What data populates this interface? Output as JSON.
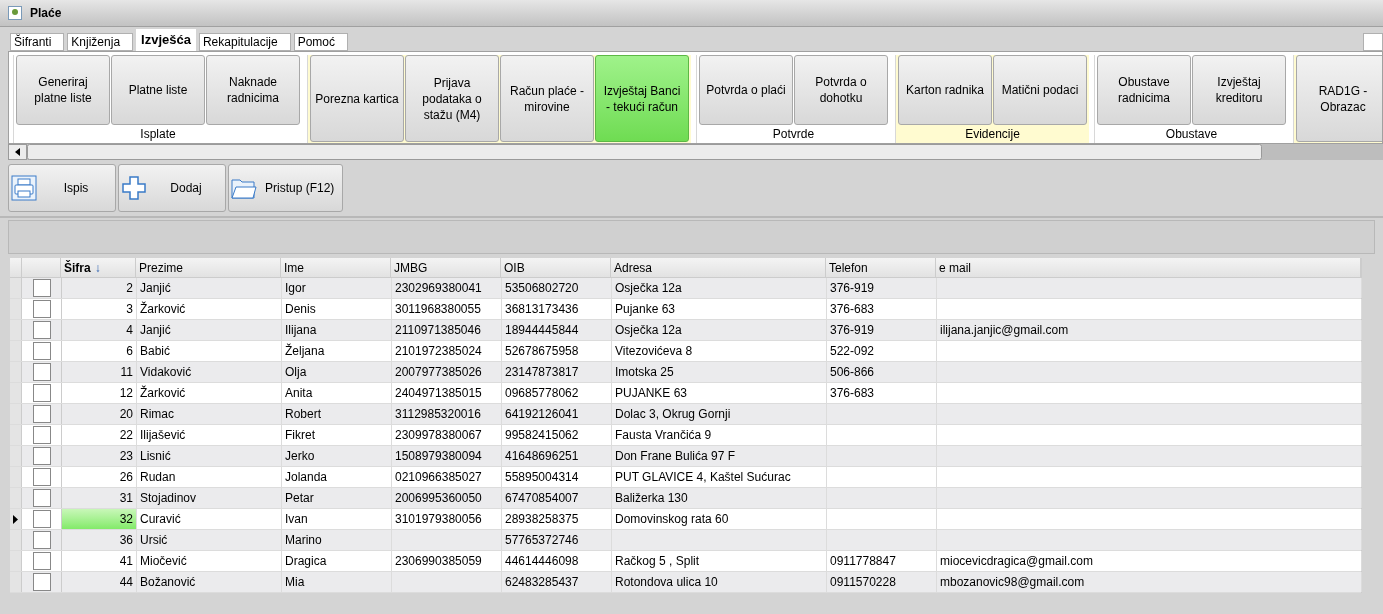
{
  "window": {
    "title": "Plaće"
  },
  "tabs": [
    {
      "label": "Šifranti",
      "selected": false
    },
    {
      "label": "Knjiženja",
      "selected": false
    },
    {
      "label": "Izvješća",
      "selected": true
    },
    {
      "label": "Rekapitulacije",
      "selected": false
    },
    {
      "label": "Pomoć",
      "selected": false
    }
  ],
  "ribbon_groups": [
    {
      "label": "Isplate",
      "color": "#ffffff",
      "buttons": [
        {
          "label": "Generiraj platne liste",
          "selected": false
        },
        {
          "label": "Platne liste",
          "selected": false
        },
        {
          "label": "Naknade radnicima",
          "selected": false
        }
      ]
    },
    {
      "color": "#fffbd0",
      "buttons": [
        {
          "label": "Porezna kartica",
          "selected": false
        },
        {
          "label": "Prijava podataka o stažu (M4)",
          "selected": false
        },
        {
          "label": "Račun plaće - mirovine",
          "selected": false
        },
        {
          "label": "Izvještaj Banci - tekući račun",
          "selected": true
        }
      ]
    },
    {
      "label": "Potvrde",
      "color": "#ffffff",
      "buttons": [
        {
          "label": "Potvrda o plaći",
          "selected": false
        },
        {
          "label": "Potvrda o dohotku",
          "selected": false
        }
      ]
    },
    {
      "label": "Evidencije",
      "color": "#fffbd0",
      "buttons": [
        {
          "label": "Karton radnika",
          "selected": false
        },
        {
          "label": "Matični podaci",
          "selected": false
        }
      ]
    },
    {
      "label": "Obustave",
      "color": "#ffffff",
      "buttons": [
        {
          "label": "Obustave radnicima",
          "selected": false
        },
        {
          "label": "Izvještaj kreditoru",
          "selected": false
        }
      ]
    },
    {
      "color": "#fffbd0",
      "buttons": [
        {
          "label": "RAD1G - Obrazac",
          "selected": false
        }
      ]
    }
  ],
  "toolbar": [
    {
      "label": "Ispis",
      "kind": "printer"
    },
    {
      "label": "Dodaj",
      "kind": "plus"
    },
    {
      "label": "Pristup (F12)",
      "kind": "folder"
    }
  ],
  "table": {
    "columns": [
      {
        "label": "Šifra",
        "sort": "↓"
      },
      {
        "label": "Prezime"
      },
      {
        "label": "Ime"
      },
      {
        "label": "JMBG"
      },
      {
        "label": "OIB"
      },
      {
        "label": "Adresa"
      },
      {
        "label": "Telefon"
      },
      {
        "label": "e mail"
      }
    ],
    "rows": [
      {
        "current": false,
        "checked": false,
        "cells": [
          "2",
          "Janjić",
          "Igor",
          "2302969380041",
          "53506802720",
          "Osječka 12a",
          "376-919",
          ""
        ]
      },
      {
        "current": false,
        "checked": false,
        "cells": [
          "3",
          "Žarković",
          "Denis",
          "3011968380055",
          "36813173436",
          "Pujanke 63",
          "376-683",
          ""
        ]
      },
      {
        "current": false,
        "checked": false,
        "cells": [
          "4",
          "Janjić",
          "Ilijana",
          "2110971385046",
          "18944445844",
          "Osječka 12a",
          "376-919",
          "ilijana.janjic@gmail.com"
        ]
      },
      {
        "current": false,
        "checked": false,
        "cells": [
          "6",
          "Babić",
          "Željana",
          "2101972385024",
          "52678675958",
          "Vitezovićeva 8",
          "522-092",
          ""
        ]
      },
      {
        "current": false,
        "checked": false,
        "cells": [
          "11",
          "Vidaković",
          "Olja",
          "2007977385026",
          "23147873817",
          "Imotska 25",
          "506-866",
          ""
        ]
      },
      {
        "current": false,
        "checked": false,
        "cells": [
          "12",
          "Žarković",
          "Anita",
          "2404971385015",
          "09685778062",
          "PUJANKE 63",
          "376-683",
          ""
        ]
      },
      {
        "current": false,
        "checked": false,
        "cells": [
          "20",
          "Rimac",
          "Robert",
          "3112985320016",
          "64192126041",
          "Dolac 3, Okrug Gornji",
          "",
          ""
        ]
      },
      {
        "current": false,
        "checked": false,
        "cells": [
          "22",
          "Ilijašević",
          "Fikret",
          "2309978380067",
          "99582415062",
          "Fausta Vrančića 9",
          "",
          ""
        ]
      },
      {
        "current": false,
        "checked": false,
        "cells": [
          "23",
          "Lisnić",
          "Jerko",
          "1508979380094",
          "41648696251",
          "Don Frane Bulića 97 F",
          "",
          ""
        ]
      },
      {
        "current": false,
        "checked": false,
        "cells": [
          "26",
          "Rudan",
          "Jolanda",
          "0210966385027",
          "55895004314",
          "PUT GLAVICE 4, Kaštel Sućurac",
          "",
          ""
        ]
      },
      {
        "current": false,
        "checked": false,
        "cells": [
          "31",
          "Stojadinov",
          "Petar",
          "2006995360050",
          "67470854007",
          "Baližerka 130",
          "",
          ""
        ]
      },
      {
        "current": true,
        "checked": false,
        "cells": [
          "32",
          "Curavić",
          "Ivan",
          "3101979380056",
          "28938258375",
          "Domovinskog rata 60",
          "",
          ""
        ]
      },
      {
        "current": false,
        "checked": false,
        "cells": [
          "36",
          "Ursić",
          "Marino",
          "",
          "57765372746",
          "",
          "",
          ""
        ]
      },
      {
        "current": false,
        "checked": false,
        "cells": [
          "41",
          "Miočević",
          "Dragica",
          "2306990385059",
          "44614446098",
          "Račkog 5 , Split",
          "0911778847",
          "miocevicdragica@gmail.com"
        ]
      },
      {
        "current": false,
        "checked": false,
        "cells": [
          "44",
          "Božanović",
          "Mia",
          "",
          "62483285437",
          "Rotondova ulica 10",
          "0911570228",
          "mbozanovic98@gmail.com"
        ]
      }
    ]
  }
}
